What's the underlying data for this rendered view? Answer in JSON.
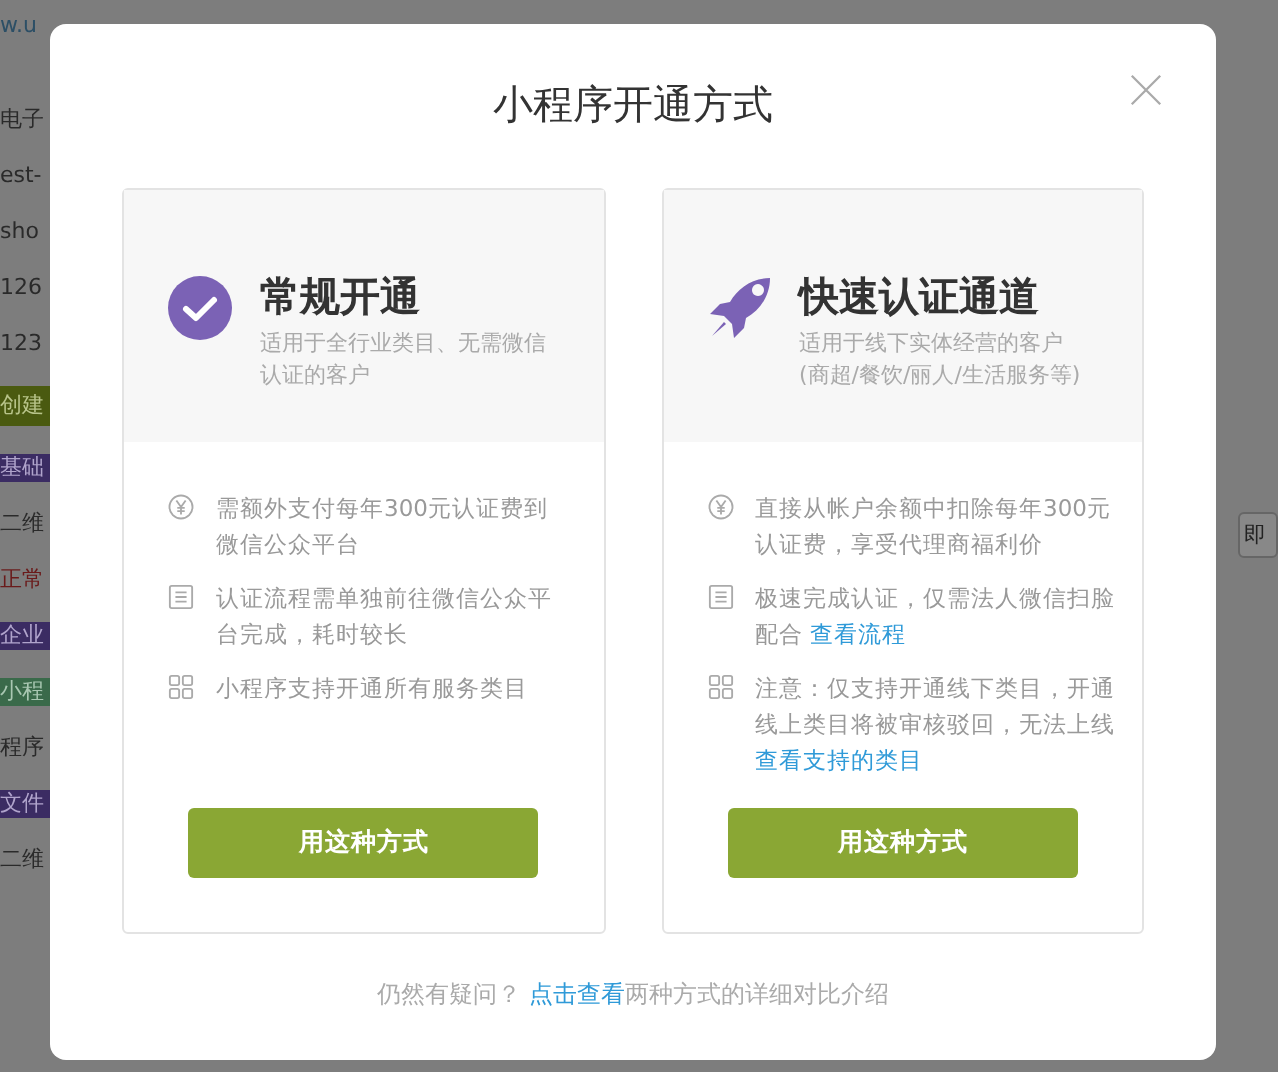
{
  "background": {
    "url_fragment": "w.u",
    "rows_left": [
      {
        "text": "电子",
        "kind": "text"
      },
      {
        "text": "est-",
        "kind": "text"
      },
      {
        "text": "sho",
        "kind": "text"
      },
      {
        "text": "126",
        "kind": "text"
      },
      {
        "text": "123",
        "kind": "text"
      },
      {
        "text": "创建",
        "kind": "button"
      },
      {
        "text": "基础",
        "kind": "tag"
      },
      {
        "text": "二维",
        "kind": "text"
      },
      {
        "text": "正常",
        "kind": "alert"
      },
      {
        "text": "企业",
        "kind": "tag"
      },
      {
        "text": "小程",
        "kind": "green"
      },
      {
        "text": "程序",
        "kind": "text"
      },
      {
        "text": "文件",
        "kind": "tag"
      },
      {
        "text": "二维",
        "kind": "text"
      }
    ],
    "right_button": "即"
  },
  "dialog": {
    "title": "小程序开通方式",
    "options": [
      {
        "title": "常规开通",
        "subtitle": "适用于全行业类目、无需微信认证的客户",
        "features": [
          {
            "text": "需额外支付每年300元认证费到微信公众平台"
          },
          {
            "text": "认证流程需单独前往微信公众平台完成，耗时较长"
          },
          {
            "text": "小程序支持开通所有服务类目"
          }
        ],
        "button": "用这种方式"
      },
      {
        "title": "快速认证通道",
        "subtitle": "适用于线下实体经营的客户(商超/餐饮/丽人/生活服务等)",
        "features": [
          {
            "text": "直接从帐户余额中扣除每年300元认证费，享受代理商福利价"
          },
          {
            "text": "极速完成认证，仅需法人微信扫脸配合",
            "link": "查看流程"
          },
          {
            "text": "注意：仅支持开通线下类目，开通线上类目将被审核驳回，无法上线",
            "link": "查看支持的类目"
          }
        ],
        "button": "用这种方式"
      }
    ],
    "footer": {
      "text": "仍然有疑问？",
      "link": "点击查看",
      "after": "两种方式的详细对比介绍"
    }
  }
}
